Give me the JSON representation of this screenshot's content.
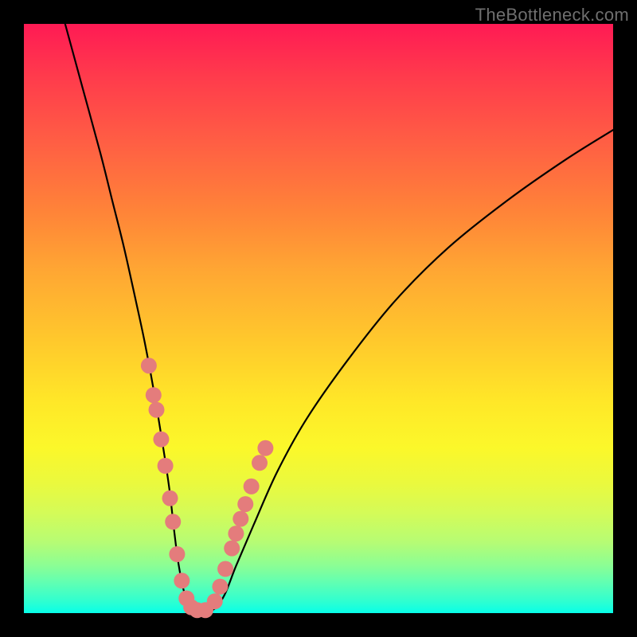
{
  "watermark": "TheBottleneck.com",
  "colors": {
    "gradient_top": "#ff1a54",
    "gradient_bottom": "#07ffe8",
    "curve": "#000000",
    "marker": "#e47c7c",
    "frame_bg": "#000000"
  },
  "chart_data": {
    "type": "line",
    "title": "",
    "xlabel": "",
    "ylabel": "",
    "xlim": [
      0,
      100
    ],
    "ylim": [
      0,
      100
    ],
    "grid": false,
    "legend": false,
    "series": [
      {
        "name": "bottleneck_curve",
        "x": [
          7,
          10,
          13,
          15,
          17,
          19,
          20.5,
          22,
          23.5,
          24.7,
          25.5,
          26.3,
          27.4,
          29.3,
          32,
          34,
          36,
          39,
          43,
          48,
          55,
          63,
          72,
          82,
          92,
          100
        ],
        "y": [
          100,
          89,
          78,
          70,
          62,
          53,
          46,
          38,
          29,
          21,
          14,
          8,
          3,
          0.5,
          0.5,
          3,
          8,
          15,
          24,
          33,
          43,
          53,
          62,
          70,
          77,
          82
        ]
      }
    ],
    "markers": {
      "name": "highlight_points",
      "x": [
        21.2,
        22.0,
        22.5,
        23.3,
        24.0,
        24.8,
        25.3,
        26.0,
        26.8,
        27.6,
        28.4,
        29.4,
        30.8,
        32.4,
        33.3,
        34.2,
        35.3,
        36.0,
        36.8,
        37.6,
        38.6,
        40.0,
        41.0
      ],
      "y": [
        42.0,
        37.0,
        34.5,
        29.5,
        25.0,
        19.5,
        15.5,
        10.0,
        5.5,
        2.5,
        1.0,
        0.5,
        0.5,
        2.0,
        4.5,
        7.5,
        11.0,
        13.5,
        16.0,
        18.5,
        21.5,
        25.5,
        28.0
      ]
    }
  }
}
